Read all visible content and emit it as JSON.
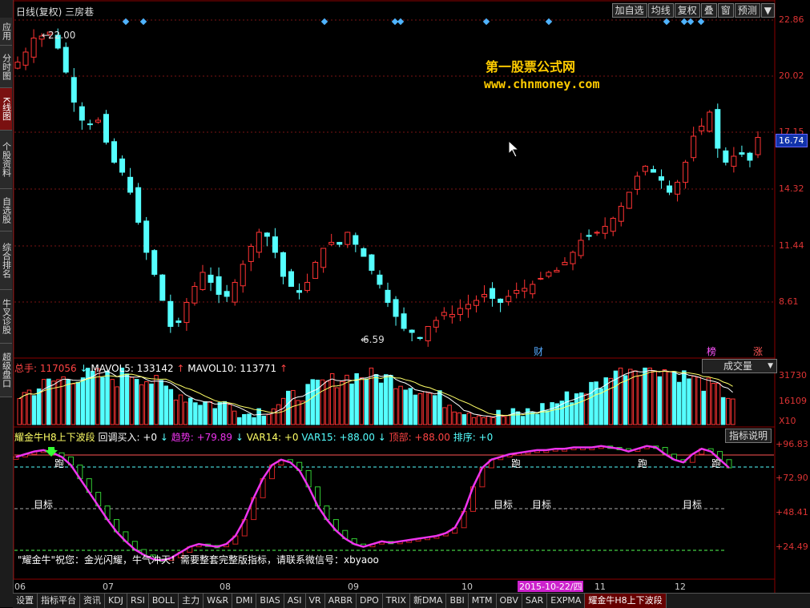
{
  "left_toolbar": [
    "应用",
    "分时图",
    "K线图",
    "个股资料",
    "自选股",
    "综合排名",
    "牛叉诊股",
    "超级盘口"
  ],
  "main": {
    "title": "日线(复权)  三房巷",
    "buttons": [
      "加自选",
      "均线",
      "复权",
      "叠",
      "窗",
      "预测",
      "▼"
    ],
    "price_axis": [
      "22.86",
      "20.02",
      "17.15",
      "14.32",
      "11.44",
      "8.61"
    ],
    "current_price": "16.74",
    "high_label": "22.00",
    "low_label": "6.59",
    "watermark_line1": "第一股票公式网",
    "watermark_line2": "www.chnmoney.com",
    "markers": [
      "财",
      "榜",
      "涨"
    ]
  },
  "volume": {
    "header_total": "总手: 117056",
    "mavol5": "MAVOL5: 133142",
    "mavol10": "MAVOL10: 113771",
    "dropdown": "成交量",
    "axis": [
      "31730",
      "16109",
      "X10"
    ],
    "colors": {
      "up": "#ff3333",
      "down": "#55ffff",
      "ma5": "#ffffff",
      "ma10": "#ffff66"
    }
  },
  "indicator": {
    "name": "耀金牛H8上下波段",
    "label_huitiao": "回调买入: +0",
    "label_qushi": "趋势: +79.89",
    "label_var14": "VAR14: +0",
    "label_var15": "VAR15: +88.00",
    "label_top": "顶部: +88.00",
    "label_rank": "排序: +0",
    "help_button": "指标说明",
    "axis": [
      "+96.83",
      "+72.90",
      "+48.41",
      "+24.49"
    ],
    "targets": [
      "目标",
      "目标",
      "目标",
      "目标"
    ],
    "run_labels": [
      "跑",
      "跑",
      "跑",
      "跑"
    ],
    "message": "\"耀金牛\"祝您：金光闪耀，牛气冲天！需要整套完整版指标，请联系微信号：xbyaoo"
  },
  "x_axis": {
    "labels": [
      "06",
      "07",
      "08",
      "09",
      "10",
      "11",
      "12"
    ],
    "highlight_date": "2015-10-22/四"
  },
  "bottom_tabs": [
    "设置",
    "指标平台",
    "资讯",
    "KDJ",
    "RSI",
    "BOLL",
    "主力",
    "W&R",
    "DMI",
    "BIAS",
    "ASI",
    "VR",
    "ARBR",
    "DPO",
    "TRIX",
    "新DMA",
    "BBI",
    "MTM",
    "OBV",
    "SAR",
    "EXPMA",
    "耀金牛H8上下波段"
  ],
  "bottom_active_tab": "耀金牛H8上下波段",
  "chart_data": {
    "type": "candlestick",
    "title": "日线(复权) 三房巷",
    "ylim": [
      6.0,
      23.0
    ],
    "close_path": [
      20.5,
      21.0,
      21.7,
      21.8,
      22.0,
      21.2,
      20.0,
      18.5,
      17.6,
      17.4,
      17.6,
      16.5,
      15.5,
      15.0,
      14.0,
      12.5,
      11.0,
      9.9,
      8.6,
      7.3,
      7.5,
      8.5,
      9.3,
      10.0,
      9.5,
      8.9,
      8.8,
      9.5,
      10.4,
      11.3,
      12.0,
      11.8,
      11.0,
      9.8,
      9.3,
      9.0,
      9.5,
      10.5,
      11.2,
      11.5,
      11.4,
      12.0,
      11.4,
      10.8,
      10.1,
      9.4,
      8.5,
      7.8,
      7.2,
      7.0,
      6.7,
      7.3,
      7.6,
      8.0,
      7.9,
      8.2,
      8.4,
      8.6,
      8.9,
      8.7,
      8.5,
      8.8,
      9.1,
      9.2,
      9.4,
      9.7,
      10.0,
      10.1,
      10.5,
      11.0,
      11.6,
      11.8,
      12.0,
      12.3,
      12.7,
      13.3,
      14.0,
      14.8,
      15.3,
      15.0,
      14.6,
      14.0,
      14.5,
      15.5,
      16.8,
      17.3,
      18.0,
      16.2,
      15.5,
      15.8,
      15.9,
      15.6,
      16.74
    ]
  }
}
